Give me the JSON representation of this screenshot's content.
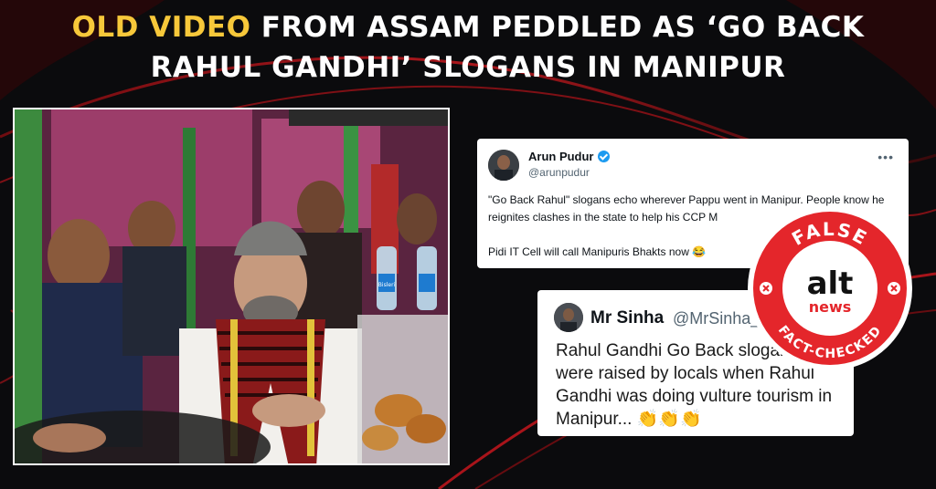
{
  "headline": {
    "accent": "OLD VIDEO",
    "line1_rest": " FROM ASSAM PEDDLED AS ‘GO BACK",
    "line2": "RAHUL GANDHI’ SLOGANS IN MANIPUR"
  },
  "photo": {
    "bottle_label": "Bisleri"
  },
  "tweet1": {
    "name": "Arun Pudur",
    "handle": "@arunpudur",
    "more": "•••",
    "body_line1": "\"Go Back Rahul\" slogans echo wherever Pappu went in Manipur. People know he reignites clashes in the state to help his CCP M",
    "body_line2": "Pidi IT Cell will call Manipuris Bhakts now 😂"
  },
  "tweet2": {
    "name": "Mr Sinha",
    "handle": "@MrSinha_",
    "body": "Rahul Gandhi Go Back slogans were raised by locals when Rahul Gandhi was doing vulture tourism in Manipur... 👏👏👏"
  },
  "badge": {
    "top_text": "FALSE",
    "logo_top": "alt",
    "logo_bottom": "news",
    "bottom_text": "FACT-CHECKED"
  },
  "colors": {
    "accent_yellow": "#f7c83a",
    "badge_red": "#e4262b",
    "swoosh_red": "#b0161c",
    "background": "#0b0b0d"
  }
}
